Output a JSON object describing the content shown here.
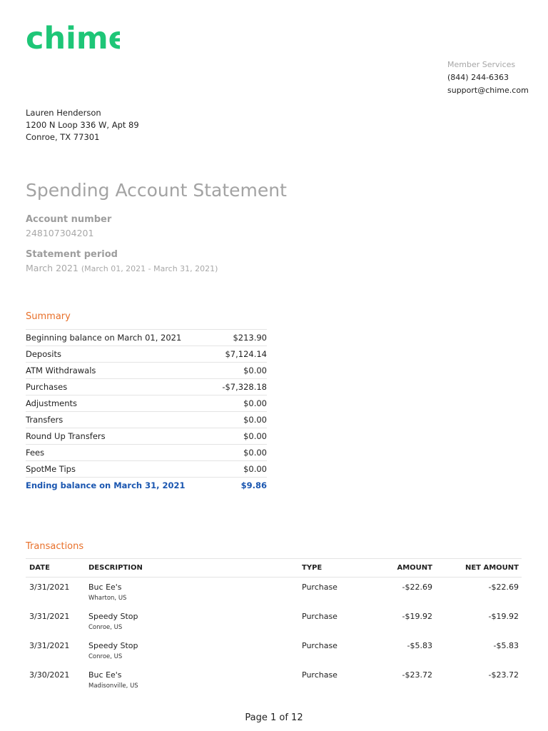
{
  "brand": {
    "name": "chime",
    "color": "#1ec677"
  },
  "member_services": {
    "title": "Member Services",
    "phone": "(844) 244-6363",
    "email": "support@chime.com"
  },
  "recipient": {
    "name": "Lauren Henderson",
    "address_line1": "1200 N Loop 336 W, Apt 89",
    "address_line2": "Conroe, TX 77301"
  },
  "statement": {
    "title": "Spending Account Statement",
    "account_number_label": "Account number",
    "account_number": "248107304201",
    "period_label": "Statement period",
    "period_month": "March 2021",
    "period_range": "(March 01, 2021 - March 31, 2021)"
  },
  "summary": {
    "title": "Summary",
    "rows": [
      {
        "label": "Beginning balance on March 01, 2021",
        "value": "$213.90"
      },
      {
        "label": "Deposits",
        "value": "$7,124.14"
      },
      {
        "label": "ATM Withdrawals",
        "value": "$0.00"
      },
      {
        "label": "Purchases",
        "value": "-$7,328.18"
      },
      {
        "label": "Adjustments",
        "value": "$0.00"
      },
      {
        "label": "Transfers",
        "value": "$0.00"
      },
      {
        "label": "Round Up Transfers",
        "value": "$0.00"
      },
      {
        "label": "Fees",
        "value": "$0.00"
      },
      {
        "label": "SpotMe Tips",
        "value": "$0.00"
      }
    ],
    "ending": {
      "label": "Ending balance on March 31, 2021",
      "value": "$9.86"
    },
    "ending_color": "#1a56b0"
  },
  "transactions": {
    "title": "Transactions",
    "columns": {
      "date": "DATE",
      "description": "DESCRIPTION",
      "type": "TYPE",
      "amount": "AMOUNT",
      "net_amount": "NET AMOUNT"
    },
    "rows": [
      {
        "date": "3/31/2021",
        "description": "Buc Ee's",
        "location": "Wharton, US",
        "type": "Purchase",
        "amount": "-$22.69",
        "net_amount": "-$22.69"
      },
      {
        "date": "3/31/2021",
        "description": "Speedy Stop",
        "location": "Conroe, US",
        "type": "Purchase",
        "amount": "-$19.92",
        "net_amount": "-$19.92"
      },
      {
        "date": "3/31/2021",
        "description": "Speedy Stop",
        "location": "Conroe, US",
        "type": "Purchase",
        "amount": "-$5.83",
        "net_amount": "-$5.83"
      },
      {
        "date": "3/30/2021",
        "description": "Buc Ee's",
        "location": "Madisonville, US",
        "type": "Purchase",
        "amount": "-$23.72",
        "net_amount": "-$23.72"
      }
    ]
  },
  "footer": {
    "page": "Page 1 of 12"
  },
  "accent_color": "#e8702a"
}
